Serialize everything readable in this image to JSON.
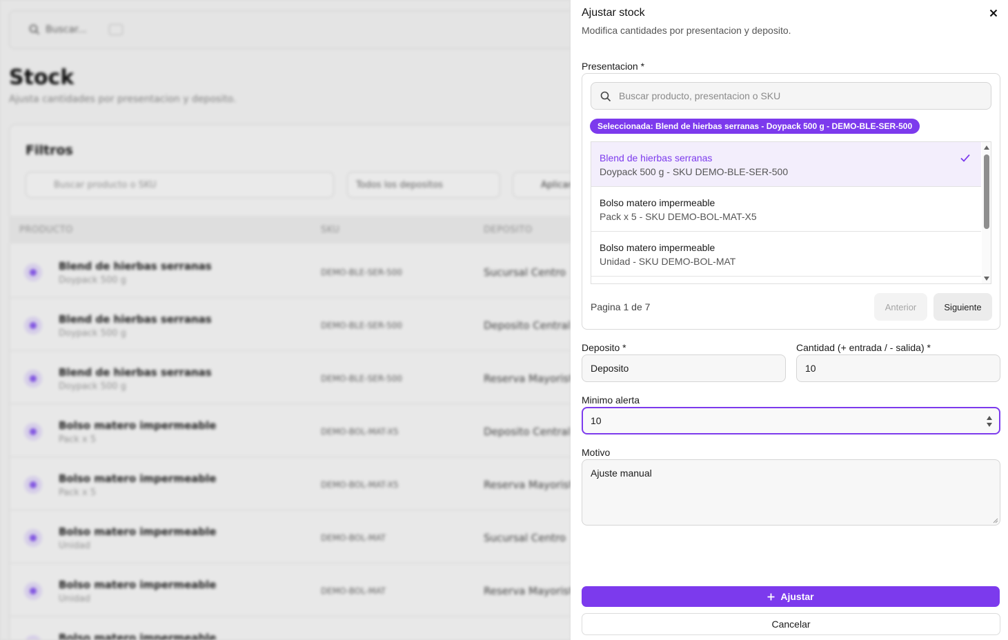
{
  "background": {
    "search": {
      "placeholder": "Buscar..."
    },
    "page_title": "Stock",
    "page_subtitle": "Ajusta cantidades por presentacion y deposito.",
    "filters": {
      "title": "Filtros",
      "search_placeholder": "Buscar producto o SKU",
      "deposit_select": "Todos los depositos",
      "apply_label": "Aplicar"
    },
    "table": {
      "headers": [
        "PRODUCTO",
        "SKU",
        "DEPOSITO"
      ],
      "rows": [
        {
          "product": "Blend de hierbas serranas",
          "presentation": "Doypack 500 g",
          "sku": "DEMO-BLE-SER-500",
          "deposit": "Sucursal Centro"
        },
        {
          "product": "Blend de hierbas serranas",
          "presentation": "Doypack 500 g",
          "sku": "DEMO-BLE-SER-500",
          "deposit": "Deposito Central"
        },
        {
          "product": "Blend de hierbas serranas",
          "presentation": "Doypack 500 g",
          "sku": "DEMO-BLE-SER-500",
          "deposit": "Reserva Mayorista"
        },
        {
          "product": "Bolso matero impermeable",
          "presentation": "Pack x 5",
          "sku": "DEMO-BOL-MAT-X5",
          "deposit": "Deposito Central"
        },
        {
          "product": "Bolso matero impermeable",
          "presentation": "Pack x 5",
          "sku": "DEMO-BOL-MAT-X5",
          "deposit": "Reserva Mayorista"
        },
        {
          "product": "Bolso matero impermeable",
          "presentation": "Unidad",
          "sku": "DEMO-BOL-MAT",
          "deposit": "Sucursal Centro"
        },
        {
          "product": "Bolso matero impermeable",
          "presentation": "Unidad",
          "sku": "DEMO-BOL-MAT",
          "deposit": "Reserva Mayorista"
        },
        {
          "product": "Bolso matero impermeable",
          "presentation": "",
          "sku": "",
          "deposit": ""
        }
      ]
    }
  },
  "drawer": {
    "title": "Ajustar stock",
    "description": "Modifica cantidades por presentacion y deposito.",
    "close_icon": "close-icon",
    "presentation": {
      "label": "Presentacion *",
      "search_placeholder": "Buscar producto, presentacion o SKU",
      "selected_badge": "Seleccionada: Blend de hierbas serranas - Doypack 500 g - DEMO-BLE-SER-500",
      "items": [
        {
          "name": "Blend de hierbas serranas",
          "detail": "Doypack 500 g - SKU DEMO-BLE-SER-500",
          "selected": true
        },
        {
          "name": "Bolso matero impermeable",
          "detail": "Pack x 5 - SKU DEMO-BOL-MAT-X5",
          "selected": false
        },
        {
          "name": "Bolso matero impermeable",
          "detail": "Unidad - SKU DEMO-BOL-MAT",
          "selected": false
        }
      ],
      "pagination": {
        "info": "Pagina 1 de 7",
        "prev_label": "Anterior",
        "next_label": "Siguiente"
      }
    },
    "deposit": {
      "label": "Deposito *",
      "value": "Deposito"
    },
    "quantity": {
      "label": "Cantidad (+ entrada / - salida) *",
      "value": "10"
    },
    "min_alert": {
      "label": "Minimo alerta",
      "value": "10"
    },
    "reason": {
      "label": "Motivo",
      "value": "Ajuste manual"
    },
    "actions": {
      "adjust_label": "Ajustar",
      "cancel_label": "Cancelar"
    }
  },
  "colors": {
    "accent": "#7c3aed",
    "selected_row_bg": "#f3eefc"
  }
}
